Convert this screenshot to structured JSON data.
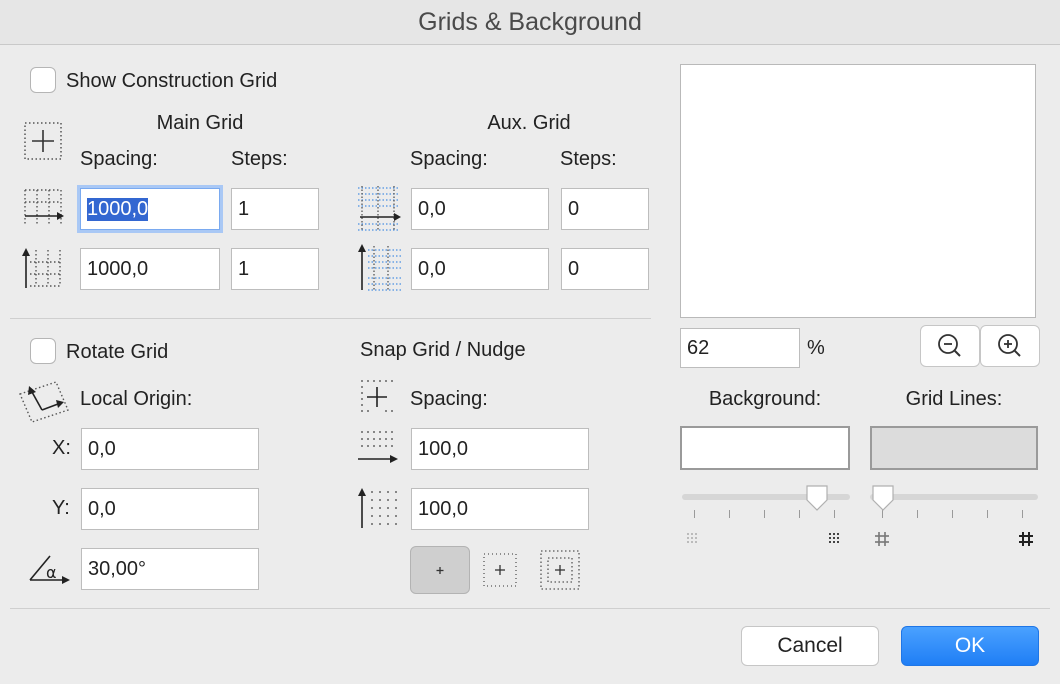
{
  "window": {
    "title": "Grids & Background"
  },
  "construction": {
    "show_label": "Show Construction Grid",
    "main_heading": "Main Grid",
    "aux_heading": "Aux. Grid",
    "spacing_label": "Spacing:",
    "steps_label": "Steps:",
    "main_x_spacing": "1000,0",
    "main_x_steps": "1",
    "main_y_spacing": "1000,0",
    "main_y_steps": "1",
    "aux_x_spacing": "0,0",
    "aux_x_steps": "0",
    "aux_y_spacing": "0,0",
    "aux_y_steps": "0"
  },
  "rotate": {
    "label": "Rotate Grid",
    "local_origin_label": "Local Origin:",
    "x_label": "X:",
    "x_value": "0,0",
    "y_label": "Y:",
    "y_value": "0,0",
    "angle_value": "30,00°"
  },
  "snap": {
    "heading": "Snap Grid / Nudge",
    "spacing_label": "Spacing:",
    "x_spacing": "100,0",
    "y_spacing": "100,0"
  },
  "preview": {
    "zoom_value": "62",
    "zoom_unit": "%",
    "background_label": "Background:",
    "grid_lines_label": "Grid Lines:",
    "background_color": "#ffffff",
    "grid_lines_color": "#dcdcdc",
    "background_slider_level": 0.86,
    "grid_lines_slider_level": 0.0
  },
  "buttons": {
    "cancel": "Cancel",
    "ok": "OK"
  },
  "colors": {
    "accent": "#1f7ef5",
    "focus_ring": "#a9c8f5",
    "selection": "#b4d5fe"
  }
}
